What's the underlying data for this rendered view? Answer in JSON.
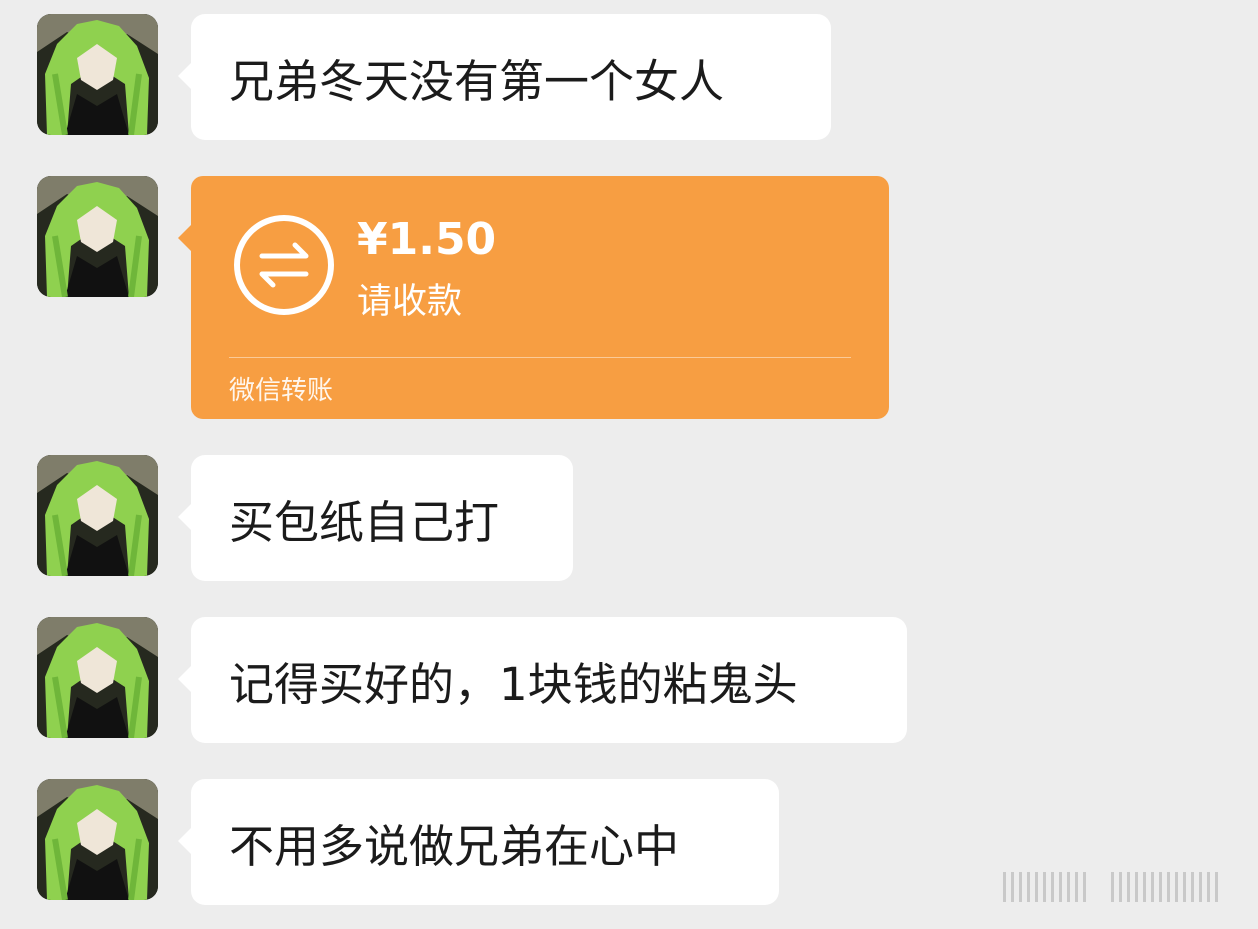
{
  "messages": [
    {
      "type": "text",
      "text": "兄弟冬天没有第一个女人"
    },
    {
      "type": "transfer",
      "amount": "¥1.50",
      "status": "请收款",
      "source": "微信转账"
    },
    {
      "type": "text",
      "text": "买包纸自己打"
    },
    {
      "type": "text",
      "text": "记得买好的，1块钱的粘鬼头"
    },
    {
      "type": "text",
      "text": "不用多说做兄弟在心中"
    }
  ],
  "colors": {
    "background": "#ededed",
    "bubble": "#ffffff",
    "transfer": "#f79e42",
    "text": "#1b1b1b"
  },
  "icons": {
    "avatar": "anime-avatar-green-hair",
    "transfer": "transfer-arrows-icon"
  }
}
